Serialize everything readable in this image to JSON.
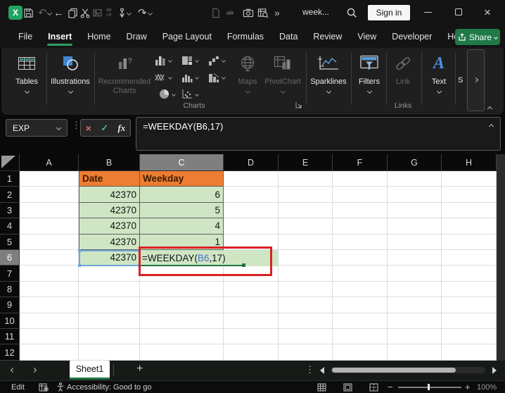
{
  "window": {
    "doc_title": "week...",
    "sign_in_label": "Sign in"
  },
  "menu": {
    "items": [
      "File",
      "Insert",
      "Home",
      "Draw",
      "Page Layout",
      "Formulas",
      "Data",
      "Review",
      "View",
      "Developer",
      "Help"
    ],
    "active_index": 1,
    "share_label": "Share"
  },
  "ribbon": {
    "tables_label": "Tables",
    "illustrations_label": "Illustrations",
    "recommended_line1": "Recommended",
    "recommended_line2": "Charts",
    "charts_group_label": "Charts",
    "maps_label": "Maps",
    "pivotchart_label": "PivotChart",
    "sparklines_label": "Sparklines",
    "filters_label": "Filters",
    "link_label": "Link",
    "text_label": "Text",
    "links_group_label": "Links",
    "symbols_partial": "S"
  },
  "formula_bar": {
    "name_box": "EXP",
    "fx_label": "fx",
    "formula": "=WEEKDAY(B6,17)"
  },
  "grid": {
    "col_headers": [
      "A",
      "B",
      "C",
      "D",
      "E",
      "F",
      "G",
      "H"
    ],
    "row_labels": [
      "1",
      "2",
      "3",
      "4",
      "5",
      "6",
      "7",
      "8",
      "9",
      "10",
      "11",
      "12"
    ],
    "selected_col": "C",
    "selected_row": "6",
    "header_row": {
      "date": "Date",
      "weekday": "Weekday"
    },
    "data_rows": [
      {
        "row": "2",
        "date": "42370",
        "weekday": "6"
      },
      {
        "row": "3",
        "date": "42370",
        "weekday": "5"
      },
      {
        "row": "4",
        "date": "42370",
        "weekday": "4"
      },
      {
        "row": "5",
        "date": "42370",
        "weekday": "1"
      },
      {
        "row": "6",
        "date": "42370",
        "weekday_formula": {
          "pre": "=WEEKDAY(",
          "ref": "B6",
          "post": ",17)"
        }
      }
    ],
    "colors": {
      "orange_fill": "#ED7D31",
      "green_fill": "#CFE6C5",
      "reference_blue": "#4472C4",
      "annotation_red": "#D92121",
      "selection_blue": "#6FA8DC",
      "accent_green": "#1F7A47"
    }
  },
  "sheet_bar": {
    "tabs": [
      {
        "label": "Sheet1",
        "active": true
      }
    ]
  },
  "status_bar": {
    "mode": "Edit",
    "accessibility": "Accessibility: Good to go",
    "zoom_level": "100%"
  }
}
